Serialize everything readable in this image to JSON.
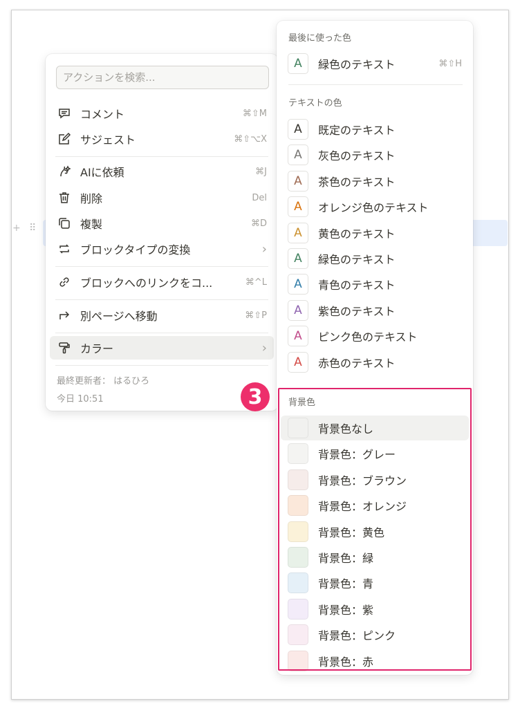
{
  "action_menu": {
    "search": {
      "placeholder": "アクションを検索..."
    },
    "items": [
      {
        "name": "comment",
        "icon": "comment-icon",
        "label": "コメント",
        "shortcut": "⌘⇧M"
      },
      {
        "name": "suggest",
        "icon": "suggest-edit-icon",
        "label": "サジェスト",
        "shortcut": "⌘⇧⌥X"
      },
      {
        "name": "ai",
        "icon": "ai-icon",
        "label": "AIに依頼",
        "shortcut": "⌘J"
      },
      {
        "name": "delete",
        "icon": "trash-icon",
        "label": "削除",
        "shortcut": "Del"
      },
      {
        "name": "duplicate",
        "icon": "duplicate-icon",
        "label": "複製",
        "shortcut": "⌘D"
      },
      {
        "name": "turn-into",
        "icon": "turn-into-icon",
        "label": "ブロックタイプの変換",
        "shortcut": "›"
      },
      {
        "name": "copy-link",
        "icon": "link-icon",
        "label": "ブロックへのリンクをコ...",
        "shortcut": "⌘^L"
      },
      {
        "name": "move-to",
        "icon": "move-to-icon",
        "label": "別ページへ移動",
        "shortcut": "⌘⇧P"
      },
      {
        "name": "color",
        "icon": "paint-roller-icon",
        "label": "カラー",
        "shortcut": "›"
      }
    ],
    "footer": {
      "edited_by": "最終更新者： はるひろ",
      "time": "今日 10:51"
    }
  },
  "color_menu": {
    "recent": {
      "title": "最後に使った色",
      "items": [
        {
          "glyph": "A",
          "label": "緑色のテキスト",
          "color": "#448361",
          "shortcut": "⌘⇧H"
        }
      ]
    },
    "text": {
      "title": "テキストの色",
      "items": [
        {
          "glyph": "A",
          "label": "既定のテキスト",
          "color": "#37352f"
        },
        {
          "glyph": "A",
          "label": "灰色のテキスト",
          "color": "#787774"
        },
        {
          "glyph": "A",
          "label": "茶色のテキスト",
          "color": "#9f6b53"
        },
        {
          "glyph": "A",
          "label": "オレンジ色のテキスト",
          "color": "#d9730d"
        },
        {
          "glyph": "A",
          "label": "黄色のテキスト",
          "color": "#cb912f"
        },
        {
          "glyph": "A",
          "label": "緑色のテキスト",
          "color": "#448361"
        },
        {
          "glyph": "A",
          "label": "青色のテキスト",
          "color": "#337ea9"
        },
        {
          "glyph": "A",
          "label": "紫色のテキスト",
          "color": "#9065b0"
        },
        {
          "glyph": "A",
          "label": "ピンク色のテキスト",
          "color": "#c14c8a"
        },
        {
          "glyph": "A",
          "label": "赤色のテキスト",
          "color": "#d44c47"
        }
      ]
    },
    "background": {
      "title": "背景色",
      "items": [
        {
          "label": "背景色なし",
          "color": "#f1f1ef"
        },
        {
          "label": "背景色：グレー",
          "color": "#f4f4f2"
        },
        {
          "label": "背景色：ブラウン",
          "color": "#f6ecea"
        },
        {
          "label": "背景色：オレンジ",
          "color": "#fbe8da"
        },
        {
          "label": "背景色：黄色",
          "color": "#fbf2d9"
        },
        {
          "label": "背景色：緑",
          "color": "#e8f1e8"
        },
        {
          "label": "背景色：青",
          "color": "#e5f0f8"
        },
        {
          "label": "背景色：紫",
          "color": "#f3ecf9"
        },
        {
          "label": "背景色：ピンク",
          "color": "#f9ecf3"
        },
        {
          "label": "背景色：赤",
          "color": "#fbe9e7"
        }
      ]
    }
  },
  "annotation": {
    "step": "3",
    "color": "#e0246b"
  }
}
